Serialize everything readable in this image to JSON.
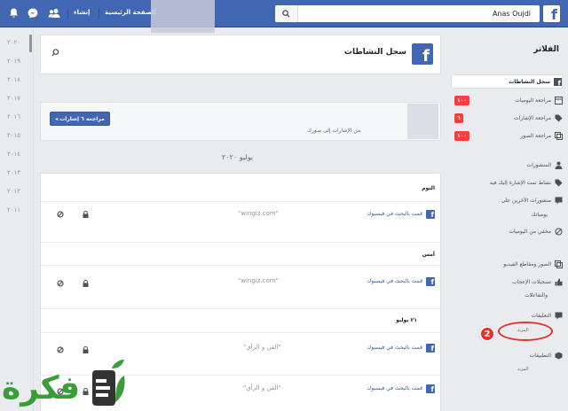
{
  "topbar": {
    "user_name": "Anas Oujdi",
    "home_label": "الصفحة الرئيسية",
    "create_label": "إنشاء",
    "logo_letter": "f",
    "icons": [
      "friends-icon",
      "messenger-icon",
      "notifications-icon",
      "search-icon"
    ]
  },
  "years": [
    "٢٠٢٠",
    "٢٠١٩",
    "٢٠١٨",
    "٢٠١٧",
    "٢٠١٦",
    "٢٠١٥",
    "٢٠١٤",
    "٢٠١٣",
    "٢٠١٢",
    "٢٠١١"
  ],
  "header": {
    "title": "سجل النشاطات",
    "logo_letter": "f"
  },
  "review": {
    "button_label": "مراجعة ٦ إشارات",
    "text": "من الإشارات إلى صورك"
  },
  "date_heading": "يوليو ٢٠٢٠",
  "sections": [
    {
      "label": "اليوم",
      "rows": [
        {
          "action": "قمت بالبحث في فيسبوك",
          "query": "\"wingiz.com\""
        }
      ]
    },
    {
      "label": "أمس",
      "rows": [
        {
          "action": "قمت بالبحث في فيسبوك",
          "query": "\"wingiz.com\""
        }
      ]
    },
    {
      "label": "٢١ يوليو",
      "rows": [
        {
          "action": "قمت بالبحث في فيسبوك",
          "query": "\"الفن و الرأي\""
        },
        {
          "action": "قمت بالبحث في فيسبوك",
          "query": "\"الفن و الرأي\""
        }
      ]
    }
  ],
  "sidebar": {
    "title": "الفلاتر",
    "items": [
      {
        "label": "سجل النشاطات",
        "icon": "facebook-icon",
        "active": true
      },
      {
        "label": "مراجعة اليوميات",
        "icon": "timeline-icon",
        "badge": "١٠٠"
      },
      {
        "label": "مراجعة الإشارات",
        "icon": "tag-icon",
        "badge": "٦"
      },
      {
        "label": "مراجعة الصور",
        "icon": "photos-icon",
        "badge": "١٠٠"
      },
      {
        "label": "المنشورات",
        "icon": "person-icon"
      },
      {
        "label": "نشاط تمت الإشارة إليك فيه",
        "icon": "tag-icon"
      },
      {
        "label": "منشورات الآخرين على",
        "icon": "comment-icon"
      },
      {
        "label": "يومياتك",
        "icon": ""
      },
      {
        "label": "مخفي من اليوميات",
        "icon": "hidden-icon"
      },
      {
        "label": "الصور ومقاطع الفيديو",
        "icon": "photos-icon"
      },
      {
        "label": "تسجيلات الإعجاب",
        "icon": "like-icon"
      },
      {
        "label": "والتفاعلات",
        "icon": ""
      },
      {
        "label": "التعليقات",
        "icon": "comment-icon"
      },
      {
        "label": "التطبيقات",
        "icon": "apps-icon"
      }
    ],
    "more_1": "المزيد",
    "more_2": "المزيد"
  },
  "annotation": {
    "number": "2",
    "color": "#e0342d"
  },
  "watermark": {
    "text": "فكرة",
    "color": "#3a9d3a"
  },
  "colors": {
    "brand": "#4267b2",
    "badge": "#fa3e3e"
  }
}
